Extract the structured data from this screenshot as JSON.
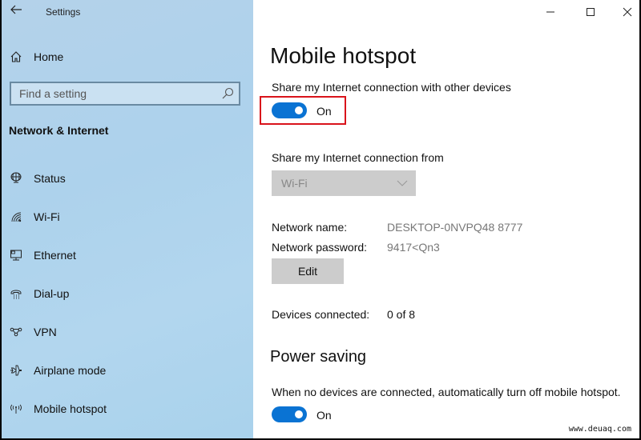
{
  "window": {
    "app_title": "Settings",
    "controls": {
      "minimize": "minimize-icon",
      "maximize": "maximize-icon",
      "close": "close-icon"
    }
  },
  "sidebar": {
    "home_label": "Home",
    "search": {
      "placeholder": "Find a setting",
      "value": ""
    },
    "section_title": "Network & Internet",
    "items": [
      {
        "label": "Status",
        "icon": "globe-monitor-icon"
      },
      {
        "label": "Wi-Fi",
        "icon": "wifi-icon"
      },
      {
        "label": "Ethernet",
        "icon": "ethernet-icon"
      },
      {
        "label": "Dial-up",
        "icon": "phone-icon"
      },
      {
        "label": "VPN",
        "icon": "vpn-icon"
      },
      {
        "label": "Airplane mode",
        "icon": "airplane-icon"
      },
      {
        "label": "Mobile hotspot",
        "icon": "hotspot-icon"
      }
    ]
  },
  "main": {
    "title": "Mobile hotspot",
    "share_label": "Share my Internet connection with other devices",
    "share_toggle": {
      "state": "On",
      "on": true
    },
    "share_from_label": "Share my Internet connection from",
    "share_from_value": "Wi-Fi",
    "network_name_label": "Network name:",
    "network_name_value": "DESKTOP-0NVPQ48 8777",
    "network_password_label": "Network password:",
    "network_password_value": "9417<Qn3",
    "edit_label": "Edit",
    "devices_connected_label": "Devices connected:",
    "devices_connected_value": "0 of 8",
    "power_saving_title": "Power saving",
    "power_saving_desc": "When no devices are connected, automatically turn off mobile hotspot.",
    "power_toggle": {
      "state": "On",
      "on": true
    }
  },
  "colors": {
    "accent": "#0a73d3",
    "highlight_box": "#d9131b"
  },
  "watermark": "www.deuaq.com"
}
